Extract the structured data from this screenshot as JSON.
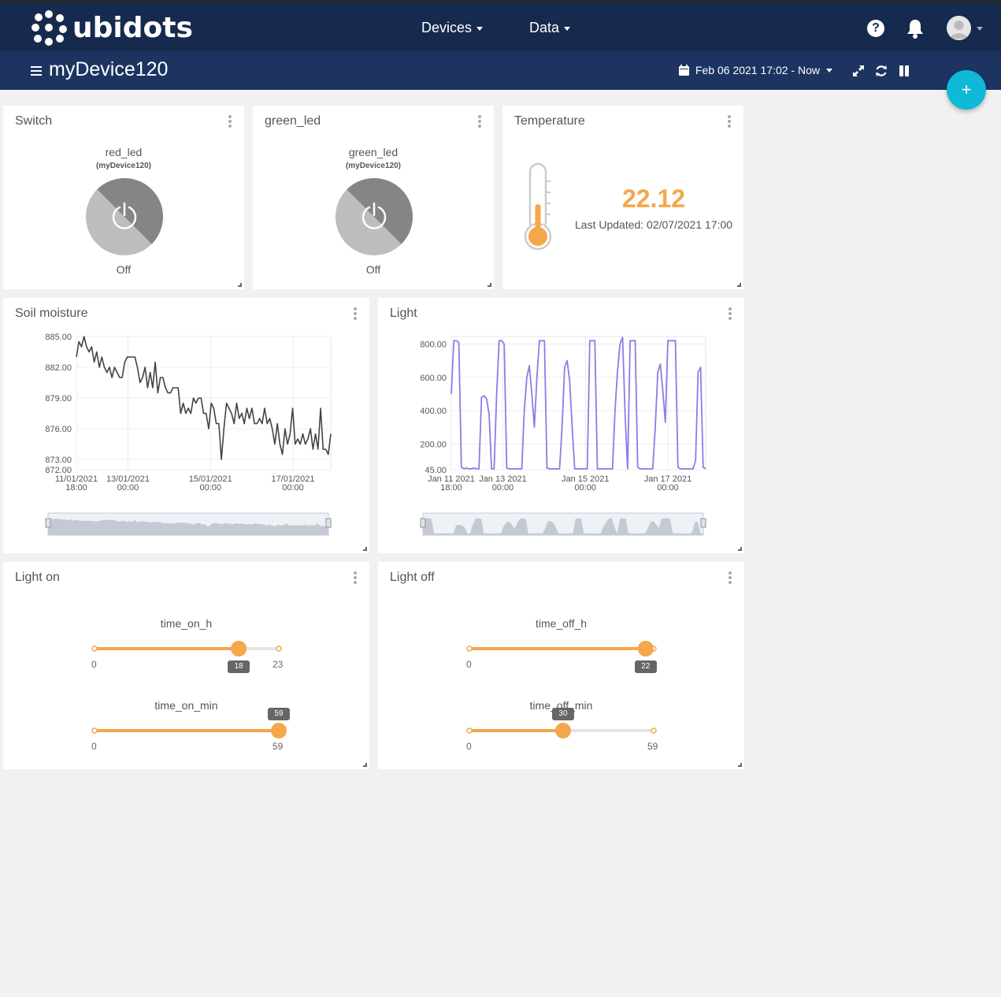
{
  "header": {
    "brand": "ubidots",
    "nav": [
      {
        "label": "Devices"
      },
      {
        "label": "Data"
      }
    ],
    "help_icon": "?"
  },
  "subbar": {
    "device_title": "myDevice120",
    "date_range": "Feb 06 2021 17:02 - Now",
    "fab_icon": "+"
  },
  "widgets": {
    "switch_red": {
      "title": "Switch",
      "variable": "red_led",
      "device": "(myDevice120)",
      "state": "Off"
    },
    "switch_green": {
      "title": "green_led",
      "variable": "green_led",
      "device": "(myDevice120)",
      "state": "Off"
    },
    "temperature": {
      "title": "Temperature",
      "value": "22.12",
      "last_updated": "Last Updated: 02/07/2021 17:00",
      "level": 0.45
    },
    "soil": {
      "title": "Soil moisture"
    },
    "light": {
      "title": "Light"
    },
    "light_on": {
      "title": "Light on",
      "sliders": [
        {
          "label": "time_on_h",
          "min": "0",
          "max": "23",
          "value": "18"
        },
        {
          "label": "time_on_min",
          "min": "0",
          "max": "59",
          "value": "59"
        }
      ]
    },
    "light_off": {
      "title": "Light off",
      "sliders": [
        {
          "label": "time_off_h",
          "min": "0",
          "max": "",
          "value": "22"
        },
        {
          "label": "time_off_min",
          "min": "0",
          "max": "59",
          "value": "30"
        }
      ]
    }
  },
  "colors": {
    "navbar": "#162a4d",
    "subbar": "#1d3461",
    "accent": "#f5a74b",
    "fab": "#0fb9d7",
    "soil_line": "#444444",
    "light_line": "#8c7ce6"
  },
  "chart_data": [
    {
      "type": "line",
      "name": "Soil moisture",
      "x_ticks": [
        {
          "date": "11/01/2021",
          "time": "18:00"
        },
        {
          "date": "13/01/2021",
          "time": "00:00"
        },
        {
          "date": "15/01/2021",
          "time": "00:00"
        },
        {
          "date": "17/01/2021",
          "time": "00:00"
        }
      ],
      "y_ticks": [
        "885.00",
        "882.00",
        "879.00",
        "876.00",
        "873.00",
        "872.00"
      ],
      "ylim": [
        872,
        885
      ],
      "x": [
        "2021-01-11T18:00",
        "2021-01-17T22:00"
      ],
      "values": [
        883,
        884.5,
        884,
        885,
        884,
        883.5,
        884,
        882.5,
        883.5,
        882,
        883,
        882,
        881.5,
        882,
        881,
        882,
        881.5,
        881,
        881,
        882.5,
        883,
        883,
        883,
        883,
        882,
        880.5,
        881,
        882,
        880,
        881.5,
        880,
        882.5,
        879.5,
        881,
        881,
        880,
        879.5,
        879.5,
        880,
        880,
        880,
        877.5,
        878.5,
        877.5,
        878,
        877.5,
        879,
        878.5,
        879,
        879,
        877.5,
        877.5,
        876,
        878.5,
        878,
        876.5,
        876.5,
        873,
        876,
        878.5,
        878,
        877.5,
        876.5,
        878.5,
        877,
        877.5,
        876.5,
        878,
        877,
        878,
        876.5,
        876.5,
        877,
        876.5,
        878,
        876.5,
        877,
        876,
        874.5,
        876.5,
        874.5,
        873.5,
        876,
        874.5,
        875.5,
        878,
        874.5,
        875,
        874.5,
        875.5,
        874.5,
        875,
        876,
        874,
        875.5,
        874,
        878,
        874,
        874,
        873.5,
        875.5
      ]
    },
    {
      "type": "line",
      "name": "Light",
      "x_ticks": [
        {
          "date": "Jan 11 2021",
          "time": "18:00"
        },
        {
          "date": "Jan 13 2021",
          "time": "00:00"
        },
        {
          "date": "Jan 15 2021",
          "time": "00:00"
        },
        {
          "date": "Jan 17 2021",
          "time": "00:00"
        }
      ],
      "y_ticks": [
        "800.00",
        "600.00",
        "400.00",
        "200.00",
        "45.00"
      ],
      "ylim": [
        45,
        845
      ],
      "x": [
        "2021-01-11T18:00",
        "2021-01-17T22:00"
      ],
      "values": [
        500,
        820,
        820,
        810,
        60,
        50,
        55,
        50,
        50,
        55,
        50,
        50,
        480,
        490,
        470,
        380,
        50,
        50,
        500,
        820,
        820,
        800,
        55,
        50,
        50,
        50,
        50,
        50,
        50,
        400,
        600,
        670,
        500,
        300,
        600,
        820,
        820,
        820,
        55,
        50,
        50,
        50,
        50,
        50,
        300,
        660,
        700,
        580,
        300,
        50,
        50,
        50,
        50,
        50,
        50,
        820,
        820,
        820,
        50,
        50,
        50,
        50,
        50,
        50,
        50,
        400,
        640,
        800,
        840,
        380,
        50,
        820,
        820,
        820,
        60,
        50,
        50,
        50,
        50,
        50,
        50,
        300,
        630,
        680,
        520,
        330,
        820,
        820,
        820,
        820,
        60,
        50,
        50,
        50,
        50,
        50,
        50,
        100,
        630,
        660,
        60,
        50
      ]
    }
  ]
}
